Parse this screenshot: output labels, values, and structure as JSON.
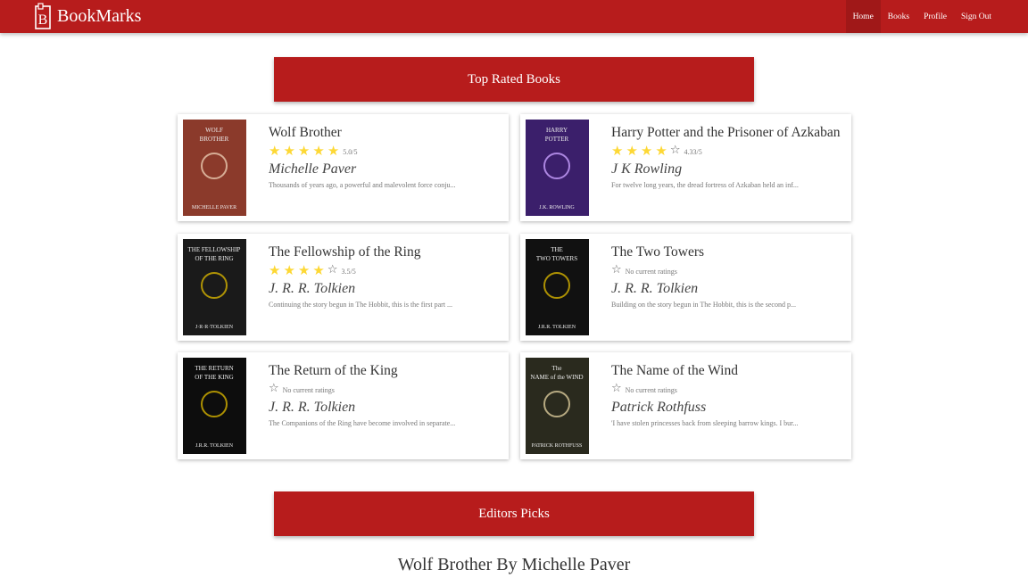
{
  "brand": {
    "name": "BookMarks",
    "logo_icon": "book-b-logo-icon"
  },
  "nav": [
    {
      "label": "Home",
      "active": true
    },
    {
      "label": "Books",
      "active": false
    },
    {
      "label": "Profile",
      "active": false
    },
    {
      "label": "Sign Out",
      "active": false
    }
  ],
  "colors": {
    "primary": "#b71c1c",
    "star": "#fdd835"
  },
  "top_rated": {
    "heading": "Top Rated Books",
    "books": [
      {
        "title": "Wolf Brother",
        "stars_filled": 5,
        "rating_text": "5.0/5",
        "author": "Michelle Paver",
        "description": "Thousands of years ago, a powerful and malevolent force conju...",
        "cover": {
          "bg": "#8b3a2b",
          "text1": "WOLF",
          "text2": "BROTHER",
          "text3": "MICHELLE PAVER"
        }
      },
      {
        "title": "Harry Potter and the Prisoner of Azkaban",
        "stars_filled": 4,
        "rating_text": "4.33/5",
        "author": "J K Rowling",
        "description": "For twelve long years, the dread fortress of Azkaban held an inf...",
        "cover": {
          "bg": "#3b1f6b",
          "text1": "HARRY",
          "text2": "POTTER",
          "text3": "J.K. ROWLING"
        }
      },
      {
        "title": "The Fellowship of the Ring",
        "stars_filled": 4,
        "rating_text": "3.5/5",
        "author": "J. R. R. Tolkien",
        "description": "Continuing the story begun in The Hobbit, this is the first part ...",
        "cover": {
          "bg": "#1a1a1a",
          "text1": "THE FELLOWSHIP",
          "text2": "OF THE RING",
          "text3": "J·R·R·TOLKIEN"
        }
      },
      {
        "title": "The Two Towers",
        "stars_filled": 0,
        "rating_text": "No current ratings",
        "author": "J. R. R. Tolkien",
        "description": "Building on the story begun in The Hobbit, this is the second p...",
        "cover": {
          "bg": "#111111",
          "text1": "THE",
          "text2": "TWO TOWERS",
          "text3": "J.R.R. TOLKIEN"
        }
      },
      {
        "title": "The Return of the King",
        "stars_filled": 0,
        "rating_text": "No current ratings",
        "author": "J. R. R. Tolkien",
        "description": "The Companions of the Ring have become involved in separate...",
        "cover": {
          "bg": "#0d0d0d",
          "text1": "THE RETURN",
          "text2": "OF THE KING",
          "text3": "J.R.R. TOLKIEN"
        }
      },
      {
        "title": "The Name of the Wind",
        "stars_filled": 0,
        "rating_text": "No current ratings",
        "author": "Patrick Rothfuss",
        "description": "'I have stolen princesses back from sleeping barrow kings. I bur...",
        "cover": {
          "bg": "#2a2a1e",
          "text1": "The",
          "text2": "NAME of the WIND",
          "text3": "PATRICK ROTHFUSS"
        }
      }
    ]
  },
  "editors_picks": {
    "heading": "Editors Picks",
    "featured_title": "Wolf Brother By Michelle Paver"
  }
}
